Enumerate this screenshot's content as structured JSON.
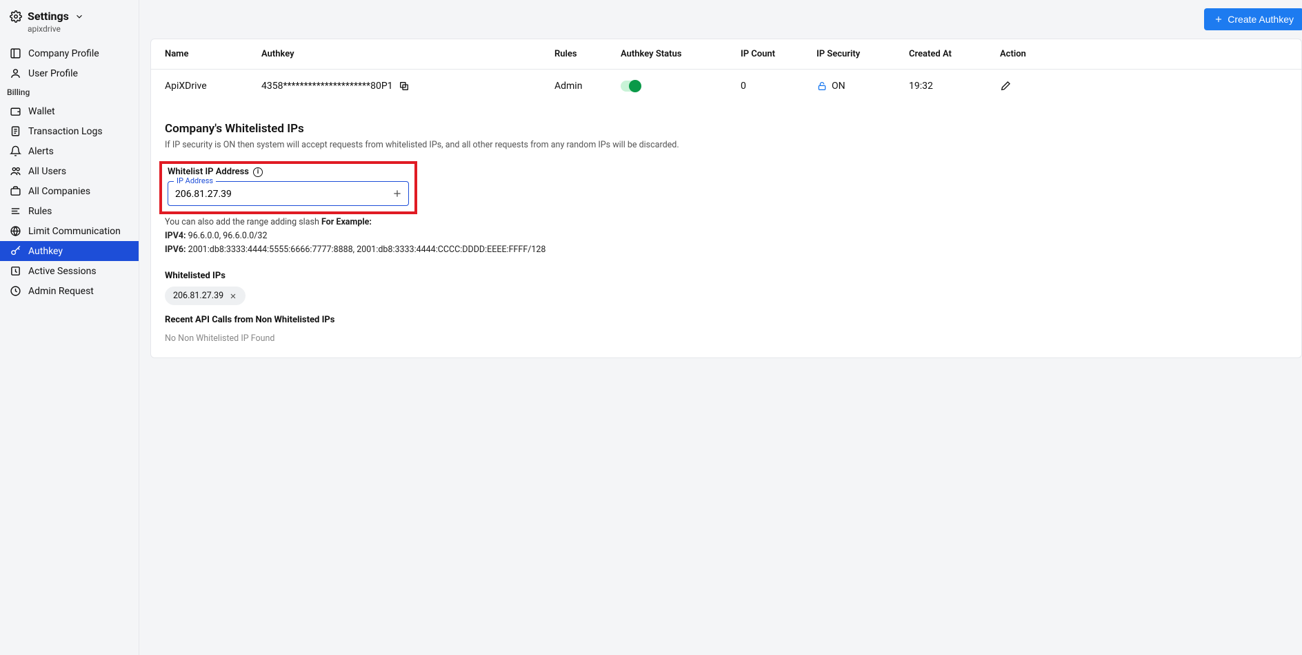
{
  "sidebar": {
    "title": "Settings",
    "subtitle": "apixdrive",
    "items_top": [
      {
        "label": "Company Profile"
      },
      {
        "label": "User Profile"
      }
    ],
    "billing_label": "Billing",
    "items_billing": [
      {
        "label": "Wallet"
      },
      {
        "label": "Transaction Logs"
      },
      {
        "label": "Alerts"
      },
      {
        "label": "All Users"
      },
      {
        "label": "All Companies"
      },
      {
        "label": "Rules"
      },
      {
        "label": "Limit Communication"
      },
      {
        "label": "Authkey"
      },
      {
        "label": "Active Sessions"
      },
      {
        "label": "Admin Request"
      }
    ]
  },
  "topbar": {
    "create_label": "Create Authkey"
  },
  "table": {
    "headers": {
      "name": "Name",
      "authkey": "Authkey",
      "rules": "Rules",
      "status": "Authkey Status",
      "ipcount": "IP Count",
      "ipsec": "IP Security",
      "created": "Created At",
      "action": "Action"
    },
    "row": {
      "name": "ApiXDrive",
      "authkey": "4358*********************80P1",
      "rules": "Admin",
      "ipcount": "0",
      "ipsec": "ON",
      "created": "19:32"
    }
  },
  "whitelist": {
    "title": "Company's Whitelisted IPs",
    "desc": "If IP security is ON then system will accept requests from whitelisted IPs, and all other requests from any random IPs will be discarded.",
    "field_label": "Whitelist IP Address",
    "float_label": "IP Address",
    "value": "206.81.27.39",
    "range_note_pre": "You can also add the range adding slash ",
    "range_note_bold": "For Example:",
    "ipv4_label": "IPV4:",
    "ipv4_ex": " 96.6.0.0, 96.6.0.0/32",
    "ipv6_label": "IPV6:",
    "ipv6_ex": " 2001:db8:3333:4444:5555:6666:7777:8888, 2001:db8:3333:4444:CCCC:DDDD:EEEE:FFFF/128",
    "list_title": "Whitelisted IPs",
    "chip": "206.81.27.39",
    "recent_title": "Recent API Calls from Non Whitelisted IPs",
    "recent_empty": "No Non Whitelisted IP Found"
  }
}
